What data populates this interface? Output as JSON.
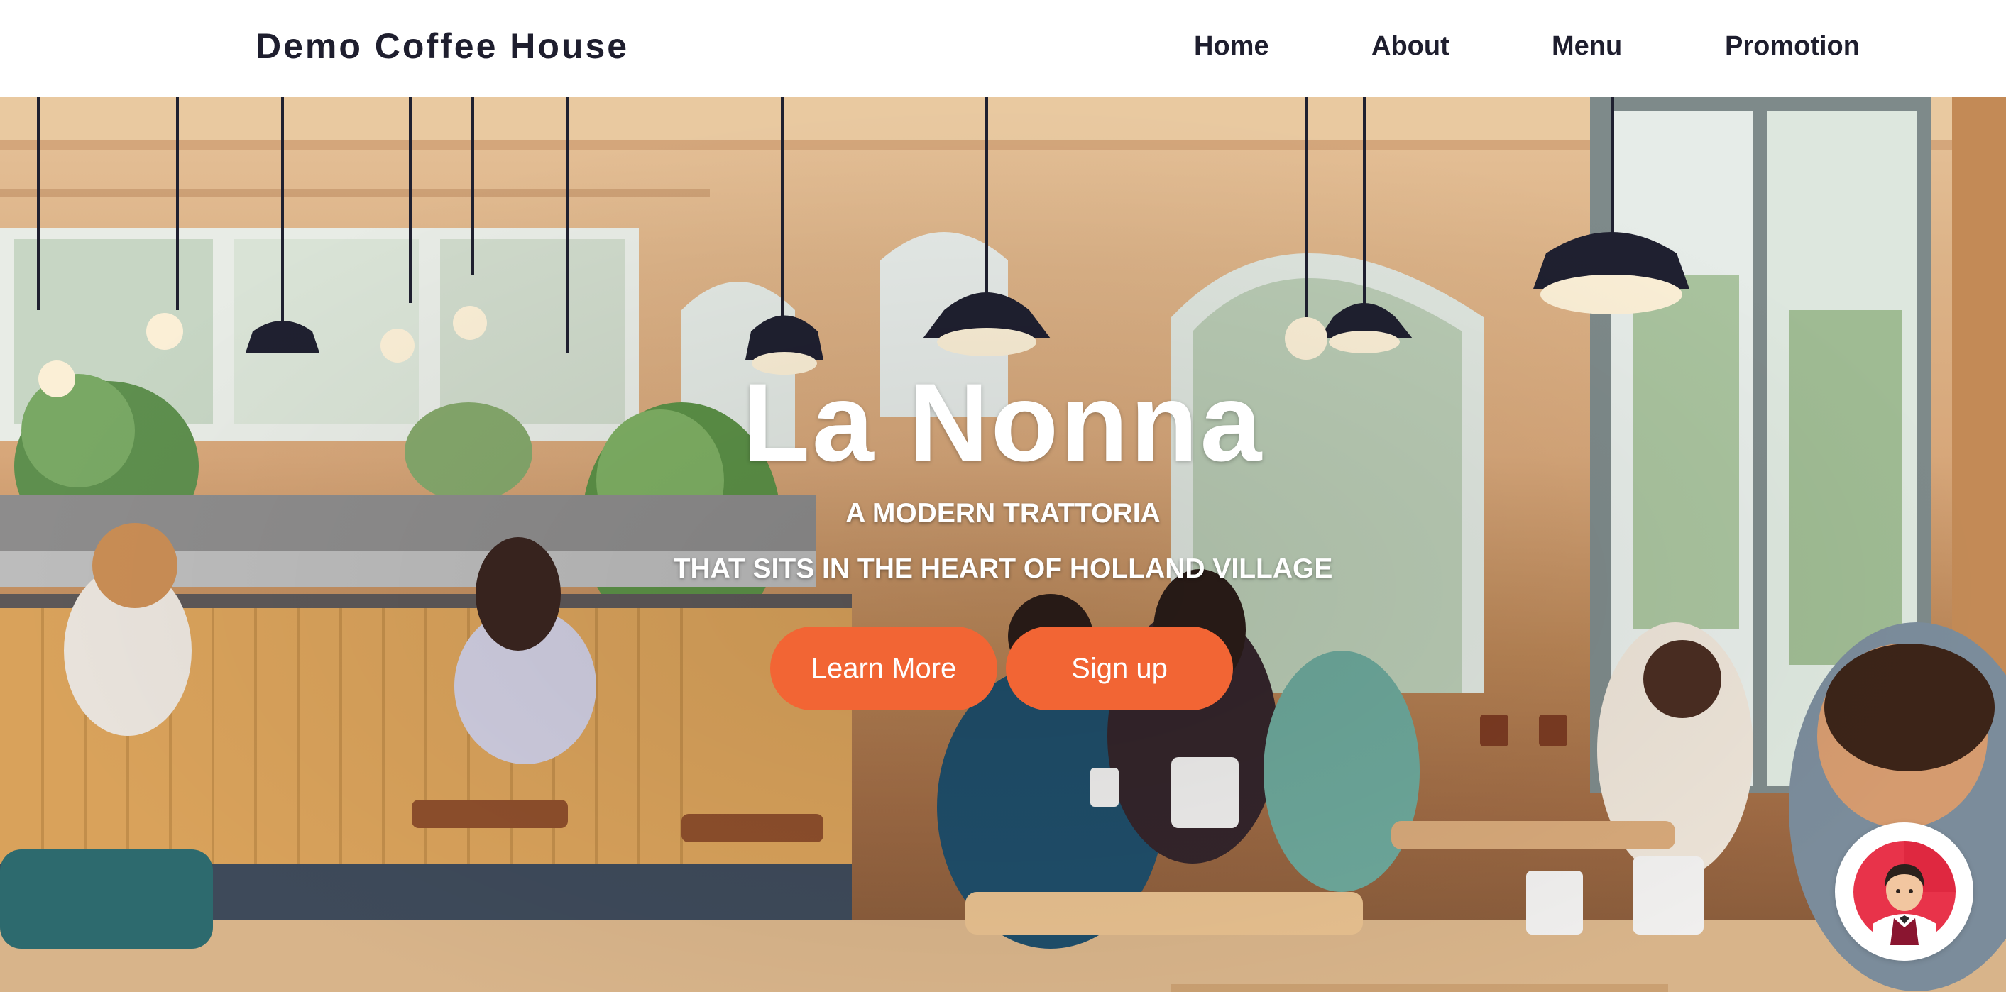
{
  "header": {
    "brand": "Demo Coffee House",
    "nav": [
      {
        "label": "Home"
      },
      {
        "label": "About"
      },
      {
        "label": "Menu"
      },
      {
        "label": "Promotion"
      }
    ]
  },
  "hero": {
    "title": "La Nonna",
    "subtitle_line1": "A MODERN TRATTORIA",
    "subtitle_line2": "THAT SITS IN THE HEART OF HOLLAND VILLAGE",
    "learn_more_label": "Learn More",
    "signup_label": "Sign up",
    "background_image": "illustrated-cafe-interior"
  },
  "chat_widget": {
    "icon": "waiter-avatar-icon"
  },
  "colors": {
    "accent": "#f26534",
    "header_text": "#1e1e2e",
    "header_bg": "#ffffff"
  }
}
